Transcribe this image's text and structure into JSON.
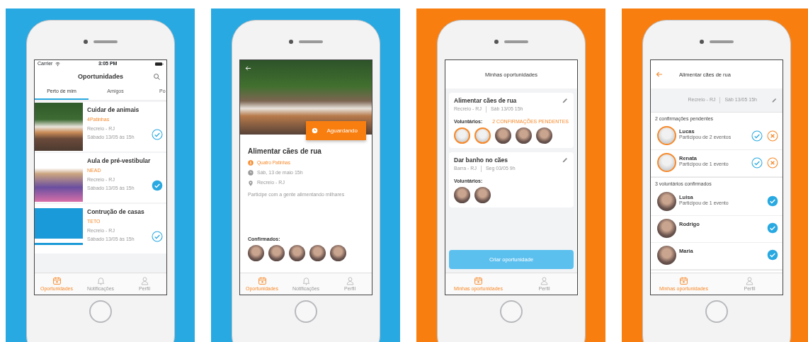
{
  "panels": [
    {
      "kind": "list",
      "color": "#29a9e1",
      "status_bar": {
        "carrier": "Carrier",
        "time": "3:05 PM"
      },
      "title": "Oportunidades",
      "tabs": [
        {
          "label": "Perto de mim",
          "selected": true
        },
        {
          "label": "Amigos",
          "selected": false
        },
        {
          "label": "Po",
          "selected": false
        }
      ],
      "cards": [
        {
          "kind": "photo",
          "title": "Cuidar de animais",
          "org": "4Patinhas",
          "location": "Recreio - RJ",
          "date": "Sábado 13/05 às 15h",
          "confirmed": false
        },
        {
          "kind": "photo",
          "title": "Aula de pré-vestibular",
          "org": "NEAD",
          "location": "Recreio - RJ",
          "date": "Sábado 13/05 às 15h",
          "confirmed": true
        },
        {
          "kind": "logo",
          "title": "Contrução de casas",
          "org": "TETO",
          "location": "Recreio - RJ",
          "date": "Sábado 13/05 às 15h",
          "confirmed": false
        }
      ],
      "tab_bar": [
        {
          "label": "Oportunidades",
          "kind": "events",
          "selected": true
        },
        {
          "label": "Notificações",
          "kind": "notifications",
          "selected": false
        },
        {
          "label": "Perfil",
          "kind": "profile",
          "selected": false
        }
      ]
    },
    {
      "kind": "detail",
      "color": "#29a9e1",
      "status_button": "Aguardando",
      "title": "Alimentar cães de rua",
      "org": "Quatro Patinhas",
      "date": "Sáb, 13 de maio 15h",
      "location": "Recreio - RJ",
      "description": "Participe com a gente alimentando milhares",
      "confirmed_label": "Confirmados:",
      "avatars": [
        {
          "pending": false
        },
        {
          "pending": false
        },
        {
          "pending": false
        },
        {
          "pending": false
        },
        {
          "pending": false
        }
      ],
      "tab_bar": [
        {
          "label": "Oportunidades",
          "kind": "events",
          "selected": true
        },
        {
          "label": "Notificações",
          "kind": "notifications",
          "selected": false
        },
        {
          "label": "Perfil",
          "kind": "profile",
          "selected": false
        }
      ]
    },
    {
      "kind": "mine",
      "color": "#f97e10",
      "title": "Minhas oportunidades",
      "cards": [
        {
          "title": "Alimentar cães de rua",
          "location": "Recreio - RJ",
          "date": "Sáb 13/05 15h",
          "volunteers_label": "Voluntários:",
          "pending_note": "2 CONFIRMAÇÕES PENDENTES",
          "avatars": [
            {
              "pending": true
            },
            {
              "pending": true
            },
            {
              "pending": false
            },
            {
              "pending": false
            },
            {
              "pending": false
            }
          ]
        },
        {
          "title": "Dar banho no cães",
          "location": "Barra - RJ",
          "date": "Seg 03/05 9h",
          "volunteers_label": "Voluntários:",
          "avatars": [
            {
              "pending": false
            },
            {
              "pending": false
            }
          ]
        }
      ],
      "button": "Criar oportunidade",
      "tab_bar": [
        {
          "label": "Minhas oportunidades",
          "kind": "events",
          "selected": true
        },
        {
          "label": "Perfil",
          "kind": "profile",
          "selected": false
        }
      ]
    },
    {
      "kind": "volunteers",
      "color": "#f97e10",
      "title": "Alimentar cães de rua",
      "location": "Recreio - RJ",
      "date": "Sáb 13/05 15h",
      "sections": [
        {
          "heading": "2 confirmações pendentes",
          "people": [
            {
              "name": "Lucas",
              "note": "Participou de 2 eventos",
              "pending": true
            },
            {
              "name": "Renata",
              "note": "Participou de 1 evento",
              "pending": true
            }
          ]
        },
        {
          "heading": "3 voluntários confirmados",
          "people": [
            {
              "name": "Luisa",
              "note": "Participou de 1 evento",
              "pending": false
            },
            {
              "name": "Rodrigo",
              "pending": false
            },
            {
              "name": "Maria",
              "pending": false
            }
          ]
        }
      ],
      "tab_bar": [
        {
          "label": "Minhas oportunidades",
          "kind": "events",
          "selected": true
        },
        {
          "label": "Perfil",
          "kind": "profile",
          "selected": false
        }
      ]
    }
  ]
}
